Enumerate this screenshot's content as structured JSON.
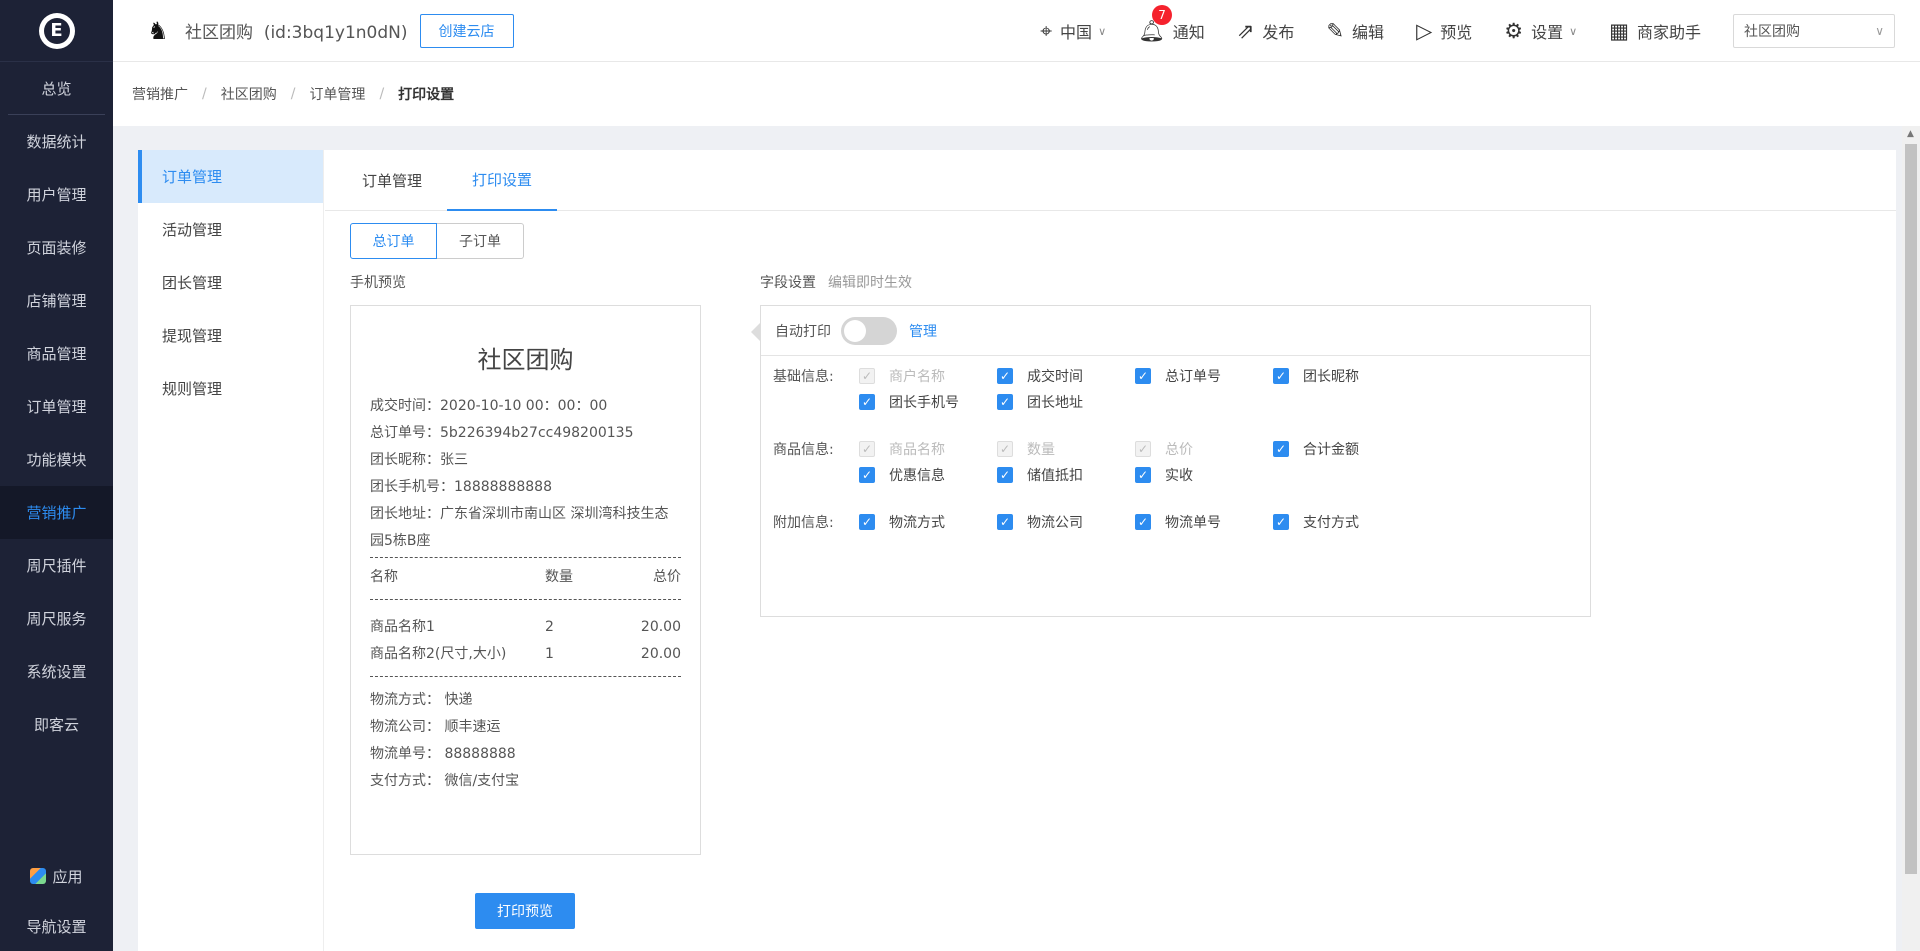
{
  "app": {
    "logo_letter": "E"
  },
  "leftnav": {
    "items": [
      "总览",
      "数据统计",
      "用户管理",
      "页面装修",
      "店铺管理",
      "商品管理",
      "订单管理",
      "功能模块",
      "营销推广",
      "周尺插件",
      "周尺服务",
      "系统设置",
      "即客云"
    ],
    "active": "营销推广",
    "bottom": [
      "应用",
      "导航设置"
    ]
  },
  "topbar": {
    "store_name": "社区团购",
    "store_id": "(id:3bq1y1n0dN)",
    "create_btn": "创建云店",
    "region": "中国",
    "notify": "通知",
    "notify_count": "7",
    "publish": "发布",
    "edit": "编辑",
    "preview": "预览",
    "settings": "设置",
    "assistant": "商家助手",
    "store_select": "社区团购"
  },
  "breadcrumb": [
    "营销推广",
    "社区团购",
    "订单管理",
    "打印设置"
  ],
  "subnav": [
    "订单管理",
    "活动管理",
    "团长管理",
    "提现管理",
    "规则管理"
  ],
  "tabs": [
    "订单管理",
    "打印设置"
  ],
  "segment": [
    "总订单",
    "子订单"
  ],
  "preview": {
    "title": "手机预览",
    "receipt_title": "社区团购",
    "lines": [
      "成交时间：2020-10-10 00：00：00",
      "总订单号：5b226394b27cc498200135",
      "团长昵称：张三",
      "团长手机号：18888888888",
      "团长地址：广东省深圳市南山区 深圳湾科技生态园5栋B座"
    ],
    "table_header": [
      "名称",
      "数量",
      "总价"
    ],
    "table_rows": [
      [
        "商品名称1",
        "2",
        "20.00"
      ],
      [
        "商品名称2(尺寸,大小)",
        "1",
        "20.00"
      ]
    ],
    "footer_lines": [
      "物流方式：  快递",
      "物流公司：  顺丰速运",
      "物流单号：  88888888",
      "支付方式：  微信/支付宝"
    ],
    "print_btn": "打印预览"
  },
  "fields": {
    "title": "字段设置",
    "hint": "编辑即时生效",
    "auto_print": "自动打印",
    "manage": "管理",
    "groups": [
      {
        "label": "基础信息:",
        "items": [
          {
            "text": "商户名称",
            "disabled": true
          },
          {
            "text": "成交时间",
            "disabled": false
          },
          {
            "text": "总订单号",
            "disabled": false
          },
          {
            "text": "团长昵称",
            "disabled": false
          },
          {
            "text": "团长手机号",
            "disabled": false
          },
          {
            "text": "团长地址",
            "disabled": false
          }
        ]
      },
      {
        "label": "商品信息:",
        "items": [
          {
            "text": "商品名称",
            "disabled": true
          },
          {
            "text": "数量",
            "disabled": true
          },
          {
            "text": "总价",
            "disabled": true
          },
          {
            "text": "合计金额",
            "disabled": false
          },
          {
            "text": "优惠信息",
            "disabled": false
          },
          {
            "text": "储值抵扣",
            "disabled": false
          },
          {
            "text": "实收",
            "disabled": false
          }
        ]
      },
      {
        "label": "附加信息:",
        "items": [
          {
            "text": "物流方式",
            "disabled": false
          },
          {
            "text": "物流公司",
            "disabled": false
          },
          {
            "text": "物流单号",
            "disabled": false
          },
          {
            "text": "支付方式",
            "disabled": false
          }
        ]
      }
    ]
  }
}
